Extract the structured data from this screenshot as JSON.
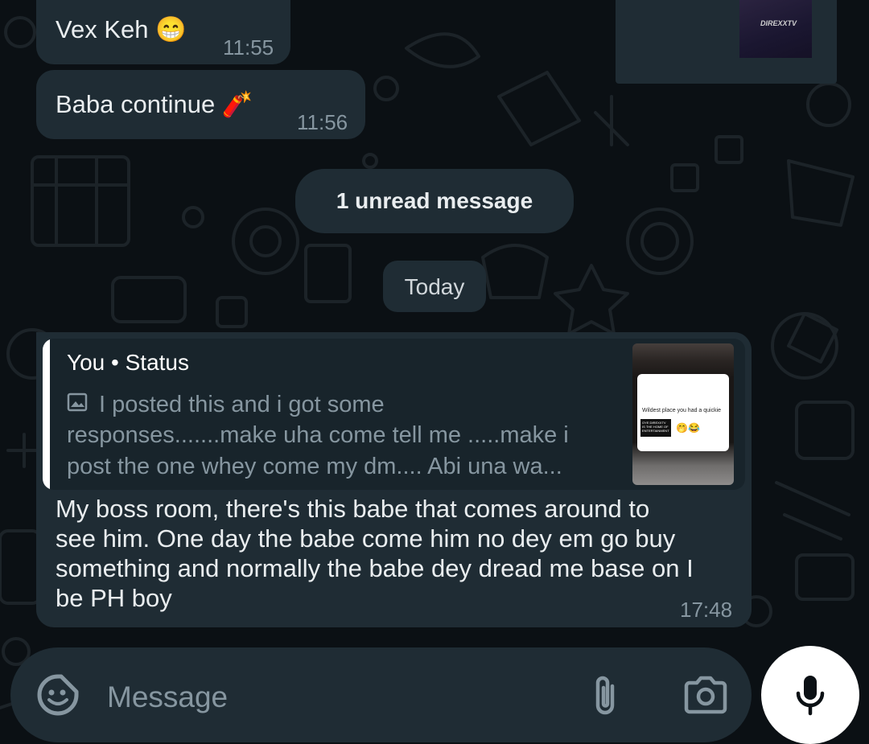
{
  "messages": [
    {
      "text": "Vex Keh 😁",
      "time": "11:55"
    },
    {
      "text": "Baba continue 🧨",
      "time": "11:56"
    }
  ],
  "unread_banner": "1 unread message",
  "date_divider": "Today",
  "top_thumbnail_text": "DIREXXTV",
  "reply_message": {
    "quote": {
      "sender": "You • Status",
      "lines": [
        "I posted this and i got some",
        "responses.......make uha come tell me .....make i",
        "post the one whey come my dm....  Abi una wa..."
      ],
      "thumbnail": {
        "caption": "Wildest place you had a quickie",
        "tag": "OYE DIREXXTV IS THE HOME OF ENTERTAINMENT",
        "emoji": "🤭😂"
      }
    },
    "lines": [
      "My boss room, there's this babe that comes around to",
      "see him. One day the babe come him no dey em go buy",
      "something and normally the babe dey dread me base on I",
      "be PH boy"
    ],
    "time": "17:48"
  },
  "input": {
    "placeholder": "Message"
  },
  "icons": {
    "sticker": "sticker-icon",
    "attach": "paperclip-icon",
    "camera": "camera-icon",
    "mic": "microphone-icon",
    "image": "image-icon"
  },
  "colors": {
    "background": "#0b1014",
    "bubble": "#1f2c34",
    "secondary_text": "#8696a0"
  }
}
